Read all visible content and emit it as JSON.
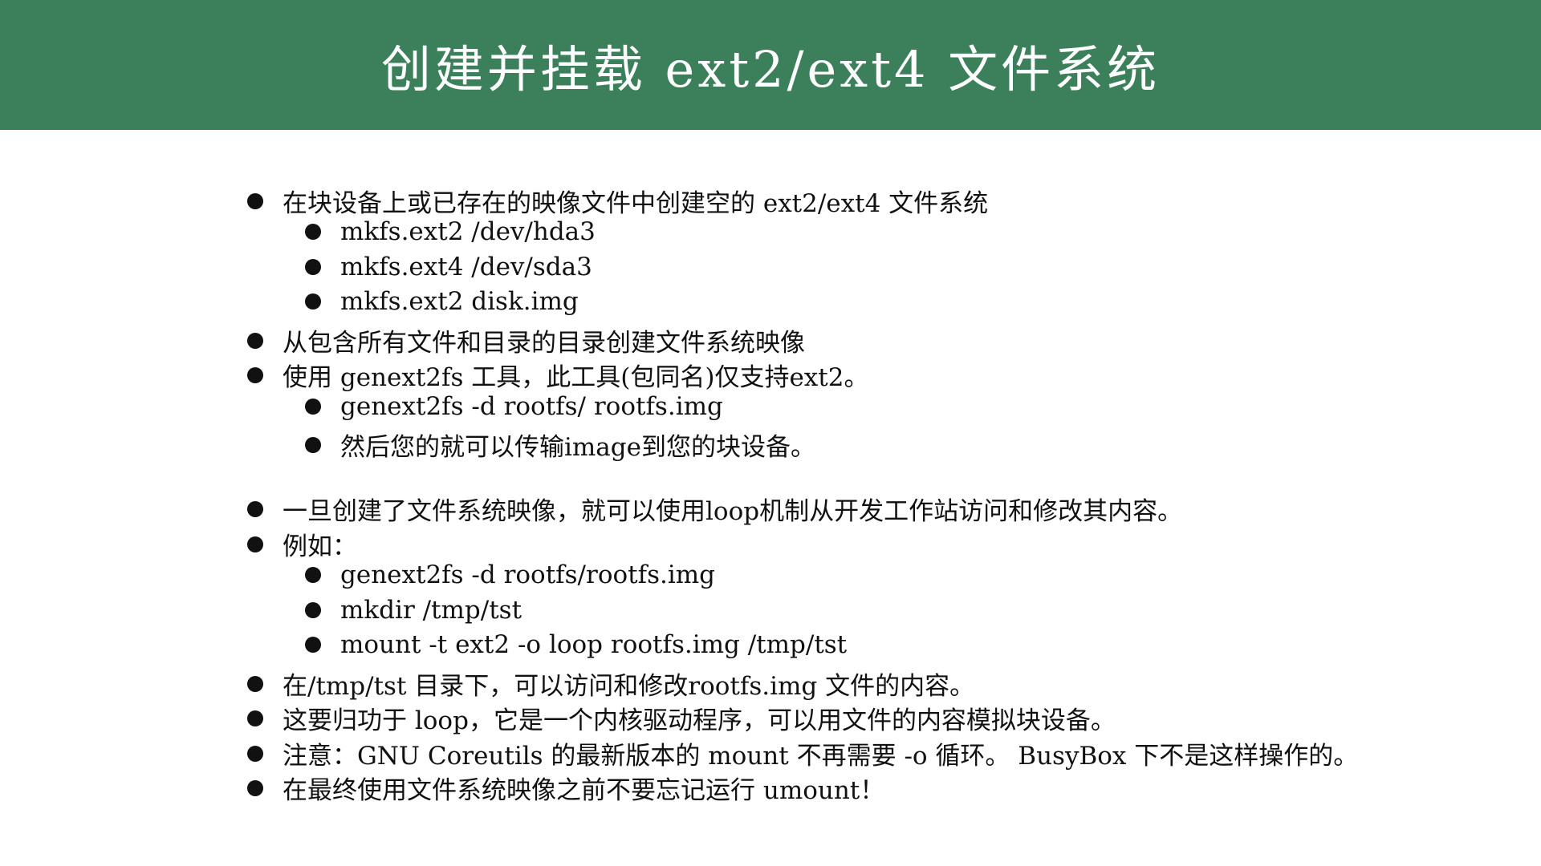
{
  "title": "创建并挂载 ext2/ext4 文件系统",
  "items": [
    {
      "level": 1,
      "text": "在块设备上或已存在的映像文件中创建空的 ext2/ext4 文件系统"
    },
    {
      "level": 2,
      "text": "mkfs.ext2 /dev/hda3"
    },
    {
      "level": 2,
      "text": "mkfs.ext4 /dev/sda3"
    },
    {
      "level": 2,
      "text": "mkfs.ext2 disk.img"
    },
    {
      "level": 1,
      "text": "从包含所有文件和目录的目录创建文件系统映像"
    },
    {
      "level": 1,
      "text": "使用 genext2fs 工具，此工具(包同名)仅支持ext2。"
    },
    {
      "level": 2,
      "text": "genext2fs -d rootfs/ rootfs.img"
    },
    {
      "level": 2,
      "text": "然后您的就可以传输image到您的块设备。"
    },
    {
      "level": 1,
      "text": "一旦创建了文件系统映像，就可以使用loop机制从开发工作站访问和修改其内容。"
    },
    {
      "level": 1,
      "text": "例如："
    },
    {
      "level": 2,
      "text": "genext2fs -d rootfs/rootfs.img"
    },
    {
      "level": 2,
      "text": "mkdir /tmp/tst"
    },
    {
      "level": 2,
      "text": "mount -t ext2 -o loop rootfs.img /tmp/tst"
    },
    {
      "level": 1,
      "text": "在/tmp/tst 目录下，可以访问和修改rootfs.img 文件的内容。"
    },
    {
      "level": 1,
      "text": "这要归功于 loop，它是一个内核驱动程序，可以用文件的内容模拟块设备。"
    },
    {
      "level": 1,
      "text": "注意：GNU Coreutils 的最新版本的 mount 不再需要 -o 循环。 BusyBox 下不是这样操作的。"
    },
    {
      "level": 1,
      "text": "在最终使用文件系统映像之前不要忘记运行 umount！"
    }
  ]
}
